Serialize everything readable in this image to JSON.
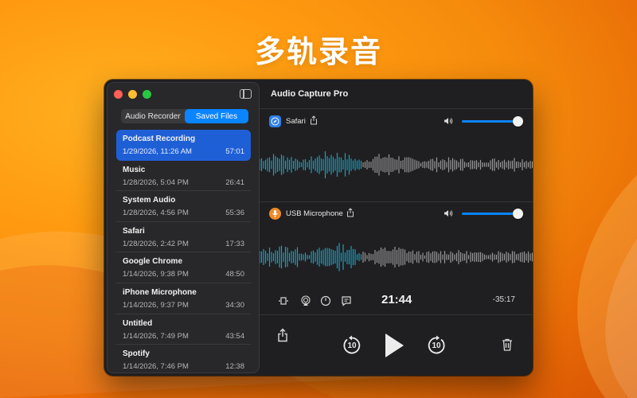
{
  "headline": "多轨录音",
  "colors": {
    "accent": "#0a84ff",
    "selected_row": "#1f5fd6",
    "mic_icon": "#f08a28",
    "safari_icon": "#2f7fe8"
  },
  "window": {
    "app_title": "Audio Capture Pro",
    "icons": [
      "close-dot",
      "minimize-dot",
      "maximize-dot",
      "sidebar-toggle-icon"
    ]
  },
  "sidebar": {
    "tabs": [
      {
        "label": "Audio Recorder",
        "active": false
      },
      {
        "label": "Saved Files",
        "active": true
      }
    ],
    "files": [
      {
        "name": "Podcast Recording",
        "date": "1/29/2026, 11:26 AM",
        "duration": "57:01",
        "selected": true
      },
      {
        "name": "Music",
        "date": "1/28/2026, 5:04 PM",
        "duration": "26:41"
      },
      {
        "name": "System Audio",
        "date": "1/28/2026, 4:56 PM",
        "duration": "55:36"
      },
      {
        "name": "Safari",
        "date": "1/28/2026, 2:42 PM",
        "duration": "17:33"
      },
      {
        "name": "Google Chrome",
        "date": "1/14/2026, 9:38 PM",
        "duration": "48:50"
      },
      {
        "name": "iPhone Microphone",
        "date": "1/14/2026, 9:37 PM",
        "duration": "34:30"
      },
      {
        "name": "Untitled",
        "date": "1/14/2026, 7:49 PM",
        "duration": "43:54"
      },
      {
        "name": "Spotify",
        "date": "1/14/2026, 7:46 PM",
        "duration": "12:38"
      }
    ]
  },
  "tracks": [
    {
      "name": "Safari",
      "icon": "safari-compass-icon",
      "volume": 1.0
    },
    {
      "name": "USB Microphone",
      "icon": "microphone-icon",
      "volume": 1.0
    }
  ],
  "player": {
    "current_time": "21:44",
    "remaining_time": "-35:17",
    "skip_back_label": "10",
    "skip_forward_label": "10",
    "tool_icons": [
      "trim-icon",
      "airplay-icon",
      "speed-icon",
      "transcript-icon"
    ],
    "control_icons": [
      "share-icon",
      "skip-back-10-icon",
      "play-icon",
      "skip-forward-10-icon",
      "trash-icon"
    ]
  }
}
